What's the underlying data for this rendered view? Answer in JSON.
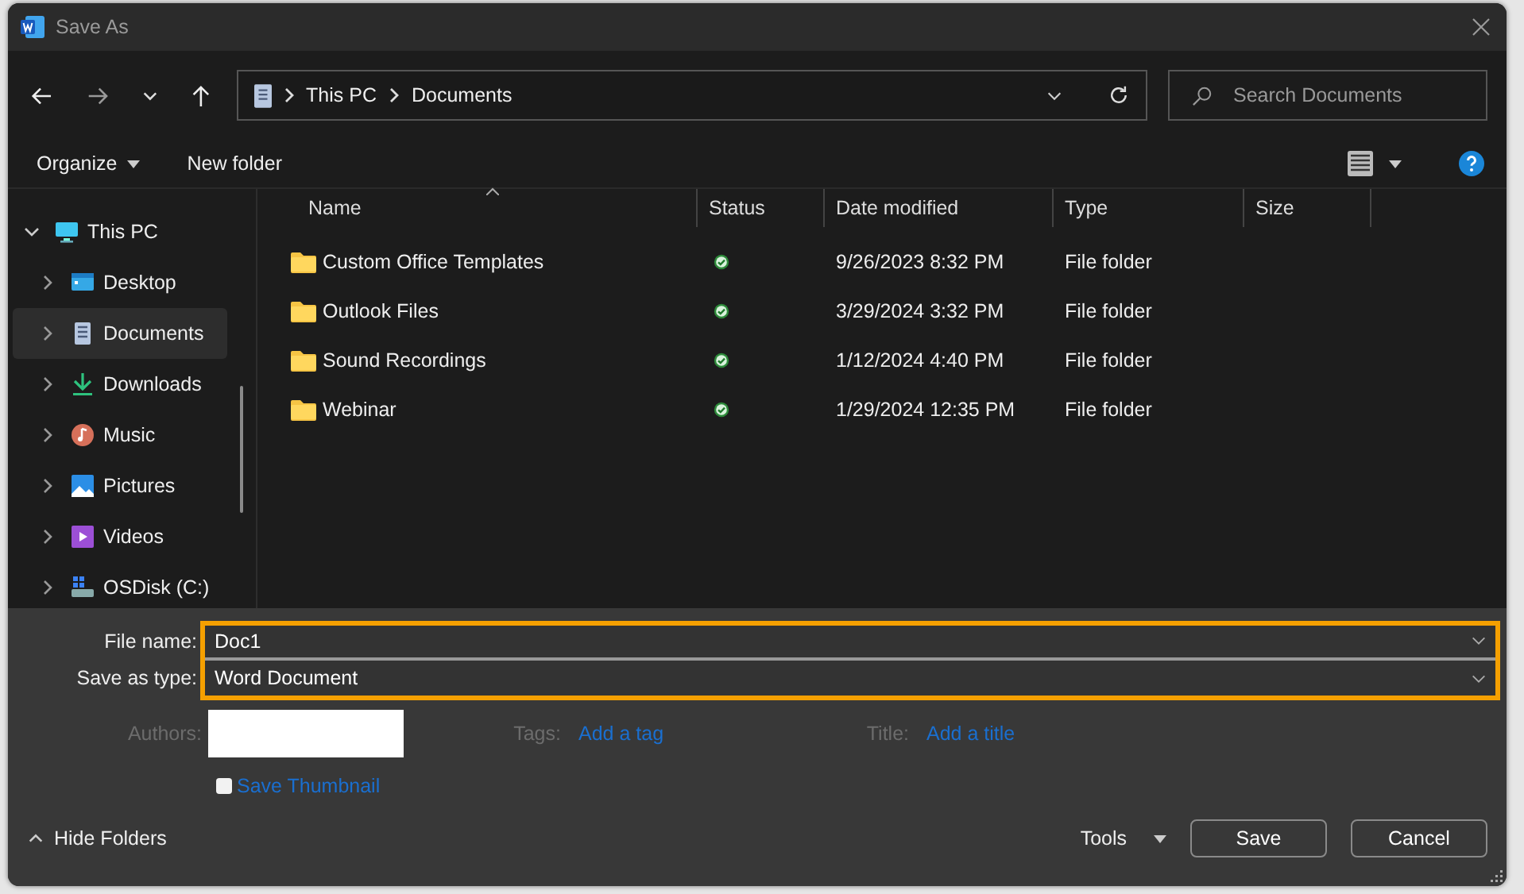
{
  "window": {
    "title": "Save As"
  },
  "address": {
    "segments": [
      "This PC",
      "Documents"
    ]
  },
  "search": {
    "placeholder": "Search Documents"
  },
  "commands": {
    "organize": "Organize",
    "new_folder": "New folder"
  },
  "sidebar": {
    "items": [
      {
        "label": "This PC",
        "kind": "pc",
        "expanded": true,
        "selected": false,
        "children": [
          {
            "label": "Desktop",
            "kind": "desktop",
            "expanded": false,
            "selected": false
          },
          {
            "label": "Documents",
            "kind": "documents",
            "expanded": false,
            "selected": true
          },
          {
            "label": "Downloads",
            "kind": "downloads",
            "expanded": false,
            "selected": false
          },
          {
            "label": "Music",
            "kind": "music",
            "expanded": false,
            "selected": false
          },
          {
            "label": "Pictures",
            "kind": "pictures",
            "expanded": false,
            "selected": false
          },
          {
            "label": "Videos",
            "kind": "videos",
            "expanded": false,
            "selected": false
          },
          {
            "label": "OSDisk (C:)",
            "kind": "disk",
            "expanded": false,
            "selected": false
          }
        ]
      }
    ]
  },
  "table": {
    "columns": [
      {
        "label": "Name",
        "sorted": true
      },
      {
        "label": "Status",
        "sorted": false
      },
      {
        "label": "Date modified",
        "sorted": false
      },
      {
        "label": "Type",
        "sorted": false
      },
      {
        "label": "Size",
        "sorted": false
      }
    ],
    "rows": [
      {
        "name": "Custom Office Templates",
        "synced": true,
        "date": "9/26/2023 8:32 PM",
        "type": "File folder"
      },
      {
        "name": "Outlook Files",
        "synced": true,
        "date": "3/29/2024 3:32 PM",
        "type": "File folder"
      },
      {
        "name": "Sound Recordings",
        "synced": true,
        "date": "1/12/2024 4:40 PM",
        "type": "File folder"
      },
      {
        "name": "Webinar",
        "synced": true,
        "date": "1/29/2024 12:35 PM",
        "type": "File folder"
      }
    ]
  },
  "form": {
    "file_name_label": "File name:",
    "file_name": "Doc1",
    "type_label": "Save as type:",
    "type": "Word Document",
    "authors_label": "Authors:",
    "tags_label": "Tags:",
    "tags_link": "Add a tag",
    "title_label": "Title:",
    "title_link": "Add a title",
    "thumbnail": {
      "label": "Save Thumbnail",
      "checked": false
    }
  },
  "footer": {
    "hide_folders": "Hide Folders",
    "tools": "Tools",
    "buttons": [
      "Save",
      "Cancel"
    ]
  }
}
